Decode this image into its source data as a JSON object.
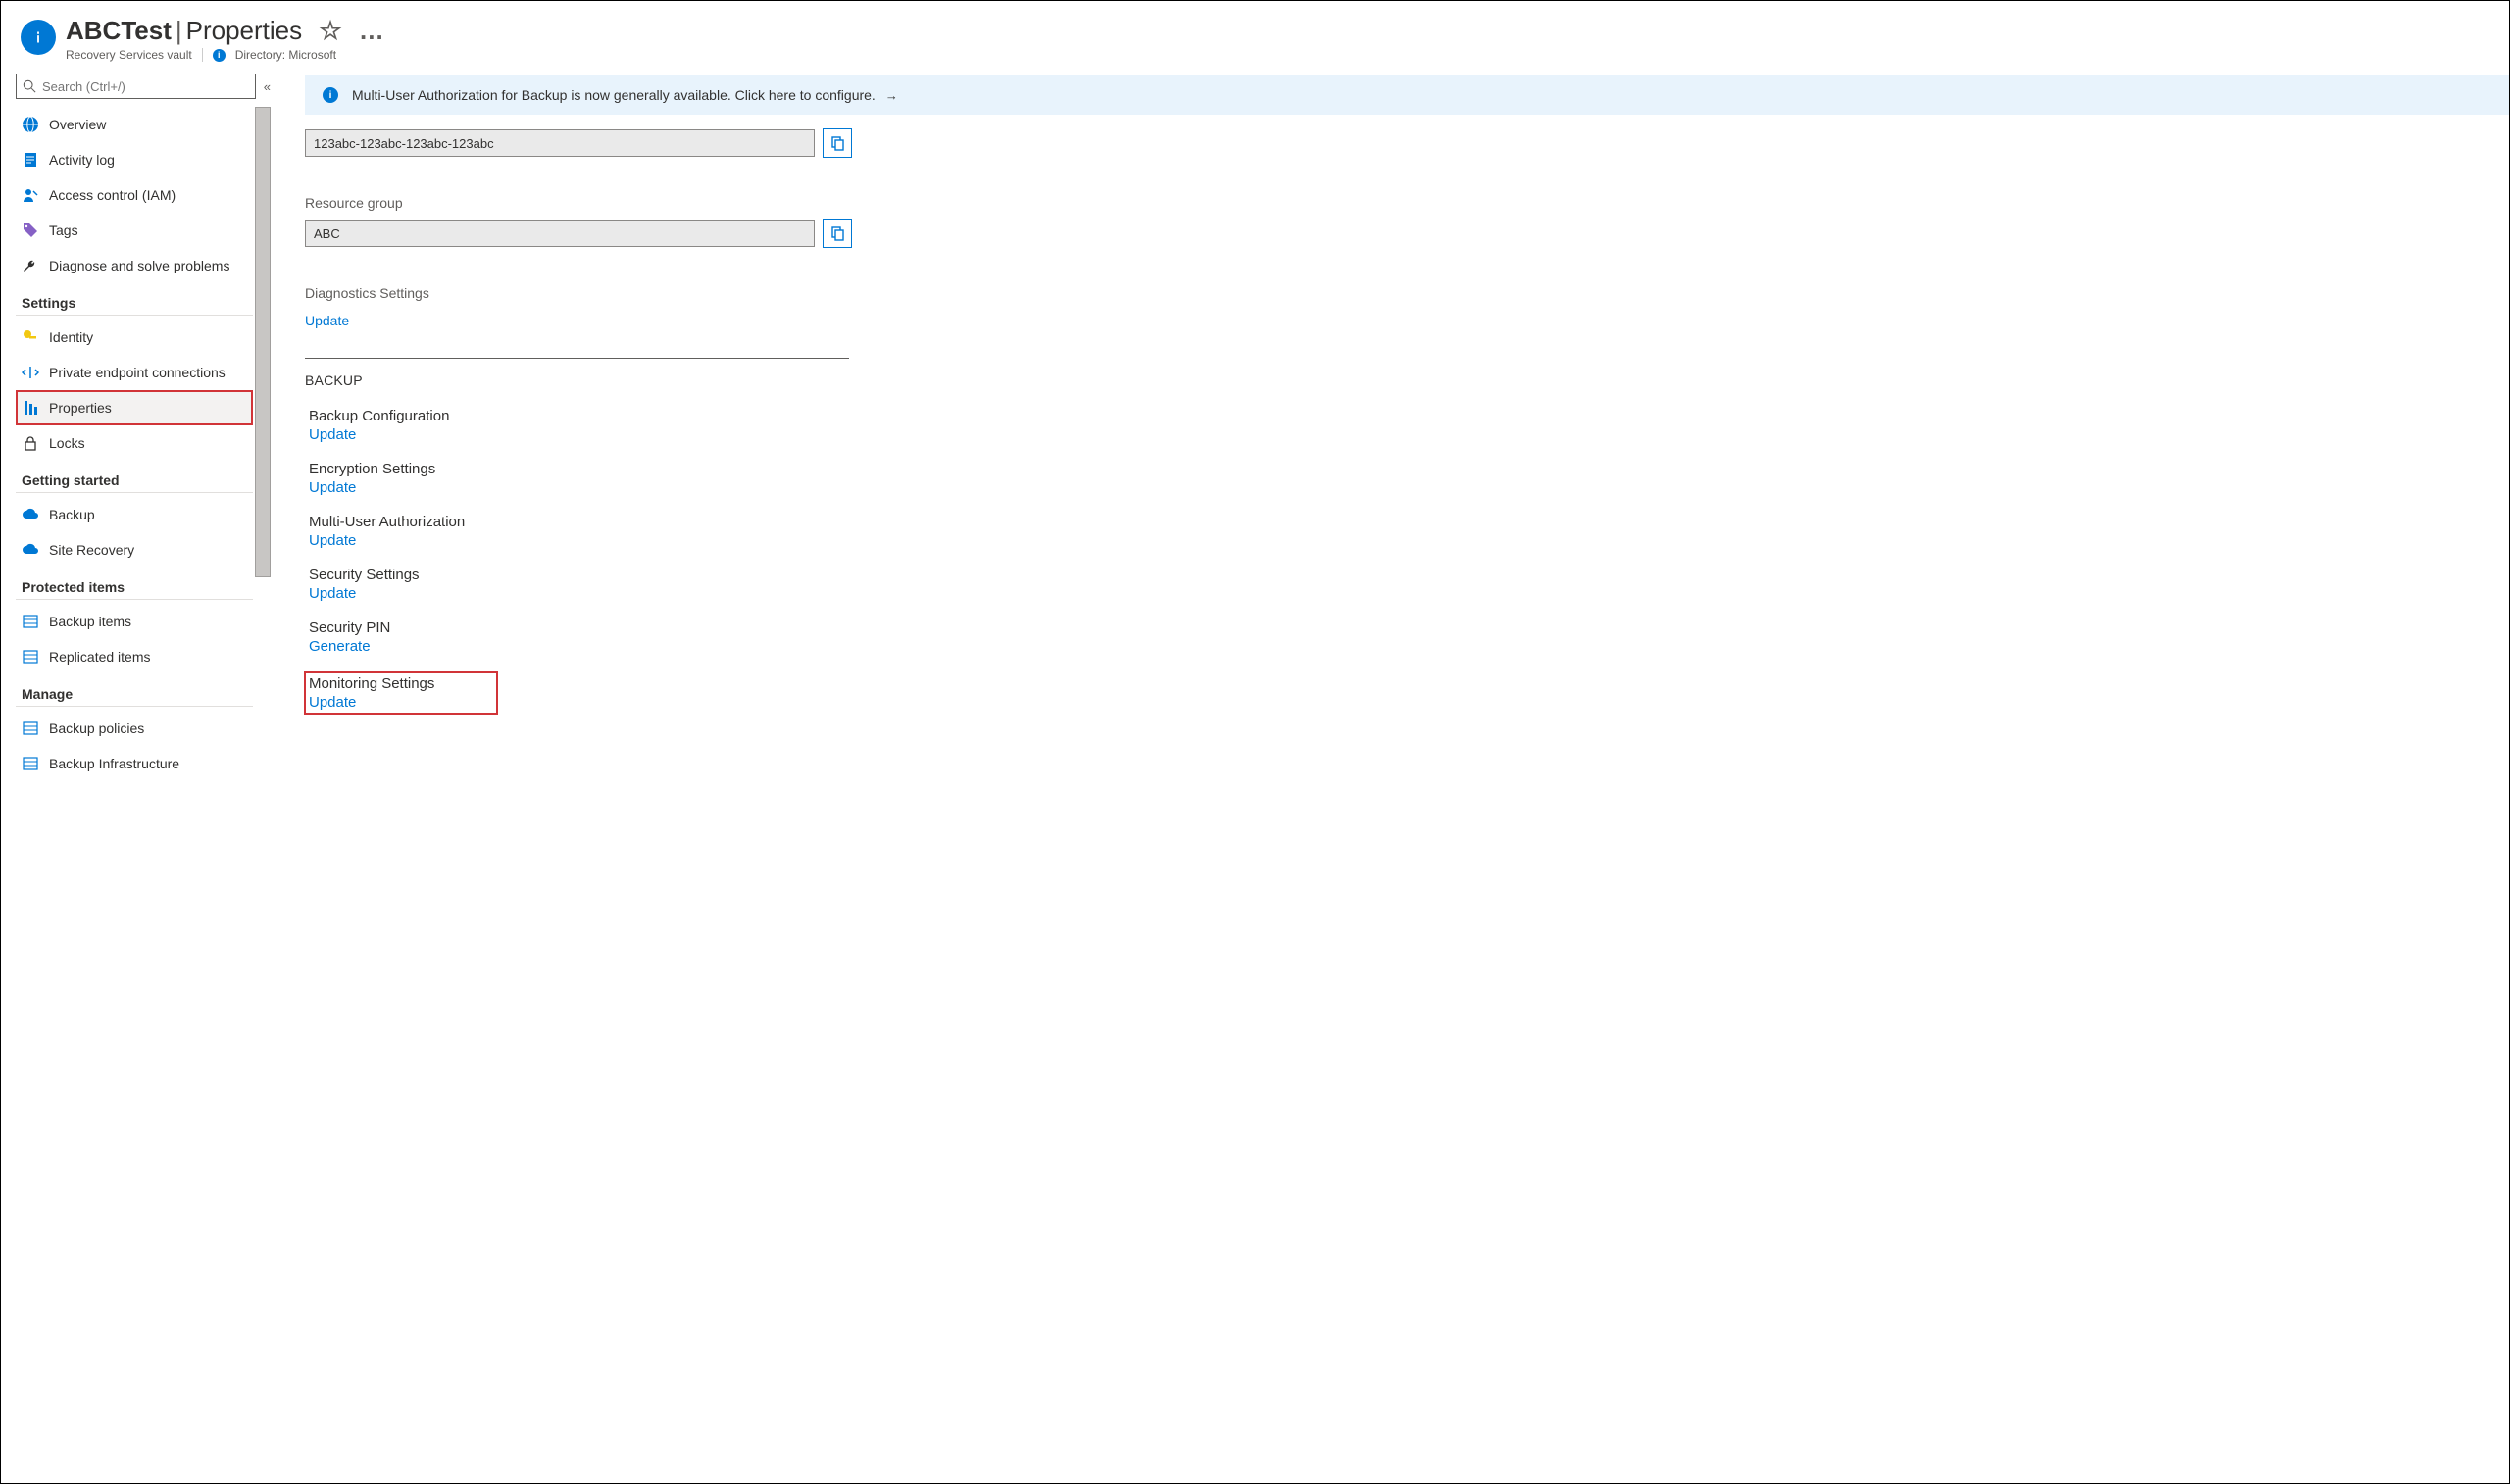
{
  "header": {
    "resource_name": "ABCTest",
    "section": "Properties",
    "subtitle": "Recovery Services vault",
    "directory_label": "Directory: Microsoft"
  },
  "search": {
    "placeholder": "Search (Ctrl+/)"
  },
  "sidebar": {
    "top": [
      {
        "label": "Overview",
        "icon": "globe"
      },
      {
        "label": "Activity log",
        "icon": "log"
      },
      {
        "label": "Access control (IAM)",
        "icon": "person"
      },
      {
        "label": "Tags",
        "icon": "tag"
      },
      {
        "label": "Diagnose and solve problems",
        "icon": "wrench"
      }
    ],
    "groups": [
      {
        "name": "Settings",
        "items": [
          {
            "label": "Identity",
            "icon": "key"
          },
          {
            "label": "Private endpoint connections",
            "icon": "endpoint"
          },
          {
            "label": "Properties",
            "icon": "props",
            "selected": true
          },
          {
            "label": "Locks",
            "icon": "lock"
          }
        ]
      },
      {
        "name": "Getting started",
        "items": [
          {
            "label": "Backup",
            "icon": "cloud"
          },
          {
            "label": "Site Recovery",
            "icon": "cloud"
          }
        ]
      },
      {
        "name": "Protected items",
        "items": [
          {
            "label": "Backup items",
            "icon": "grid"
          },
          {
            "label": "Replicated items",
            "icon": "grid"
          }
        ]
      },
      {
        "name": "Manage",
        "items": [
          {
            "label": "Backup policies",
            "icon": "grid"
          },
          {
            "label": "Backup Infrastructure",
            "icon": "grid"
          }
        ]
      }
    ]
  },
  "banner": {
    "message": "Multi-User Authorization for Backup is now generally available. Click here to configure."
  },
  "fields": {
    "id_value": "123abc-123abc-123abc-123abc",
    "rg_label": "Resource group",
    "rg_value": "ABC",
    "diag_label": "Diagnostics Settings",
    "diag_action": "Update"
  },
  "backup_heading": "BACKUP",
  "backup_blocks": [
    {
      "title": "Backup Configuration",
      "action": "Update"
    },
    {
      "title": "Encryption Settings",
      "action": "Update"
    },
    {
      "title": "Multi-User Authorization",
      "action": "Update"
    },
    {
      "title": "Security Settings",
      "action": "Update"
    },
    {
      "title": "Security PIN",
      "action": "Generate"
    },
    {
      "title": "Monitoring Settings",
      "action": "Update",
      "highlight": true
    }
  ]
}
